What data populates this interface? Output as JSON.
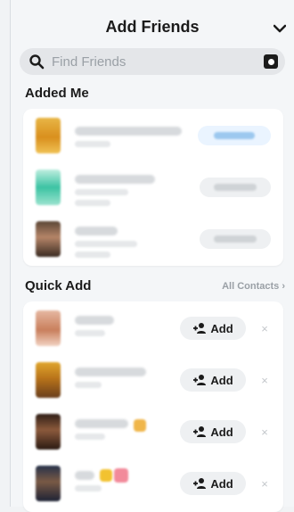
{
  "header": {
    "title": "Add Friends"
  },
  "search": {
    "placeholder": "Find Friends"
  },
  "added_me": {
    "title": "Added Me"
  },
  "quick_add": {
    "title": "Quick Add",
    "all_contacts_label": "All Contacts ›",
    "add_label": "Add",
    "dismiss_label": "×"
  },
  "colors": {
    "background": "#f4f6f8",
    "accent_blue": "#9cc8ef"
  }
}
